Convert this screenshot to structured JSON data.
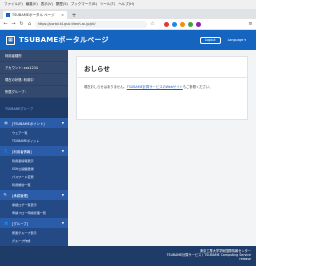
{
  "browser": {
    "menu": [
      "ファイル(F)",
      "編集(E)",
      "表示(V)",
      "履歴(S)",
      "ブックマーク(B)",
      "ツール(T)",
      "ヘルプ(H)"
    ],
    "tab_title": "TSUBAMEポータル ページ",
    "address": "https://portal.t4.gsic.titech.ac.jp/ptl/",
    "colors": {
      "accent": "#1565c0"
    }
  },
  "header": {
    "title": "TSUBAMEポータルページ",
    "logout_label": "Logout",
    "language_label": "Language ▾"
  },
  "sidebar": {
    "info": [
      {
        "label": "利用者種別"
      },
      {
        "label": "アカウント: xxx1234"
      },
      {
        "label": "現在の状態: 利用中"
      },
      {
        "label": "所属グループ:"
      }
    ],
    "link_label": "TSUBAMEグループ",
    "groups": [
      {
        "title": "[TSUBAMEポイント]",
        "items": [
          "ウェア一覧",
          "TSUBAMEポイント"
        ]
      },
      {
        "title": "[利用者情報]",
        "items": [
          "利用者情報表示",
          "SSH公開鍵登録",
          "パスワード変更",
          "利用規約一覧"
        ]
      },
      {
        "title": "[承認管理]",
        "items": [
          "承認ログ一覧表示",
          "申請フロー申請管理一覧"
        ]
      },
      {
        "title": "[グループ]",
        "items": [
          "所属グループ表示",
          "グループ作成",
          "履歴表示"
        ]
      }
    ],
    "footer_label": "お問い合わせ"
  },
  "main": {
    "title": "おしらせ",
    "notice_prefix": "現在おしらせはありません。",
    "notice_link": "TSUBAME計算サービスのWebサイト",
    "notice_suffix": "もご参照ください。"
  },
  "footer": {
    "line1": "東京工業大学学術国際情報センター",
    "line2": "TSUBAME計算サービス / TSUBAME Computing Service",
    "line3": "release"
  }
}
